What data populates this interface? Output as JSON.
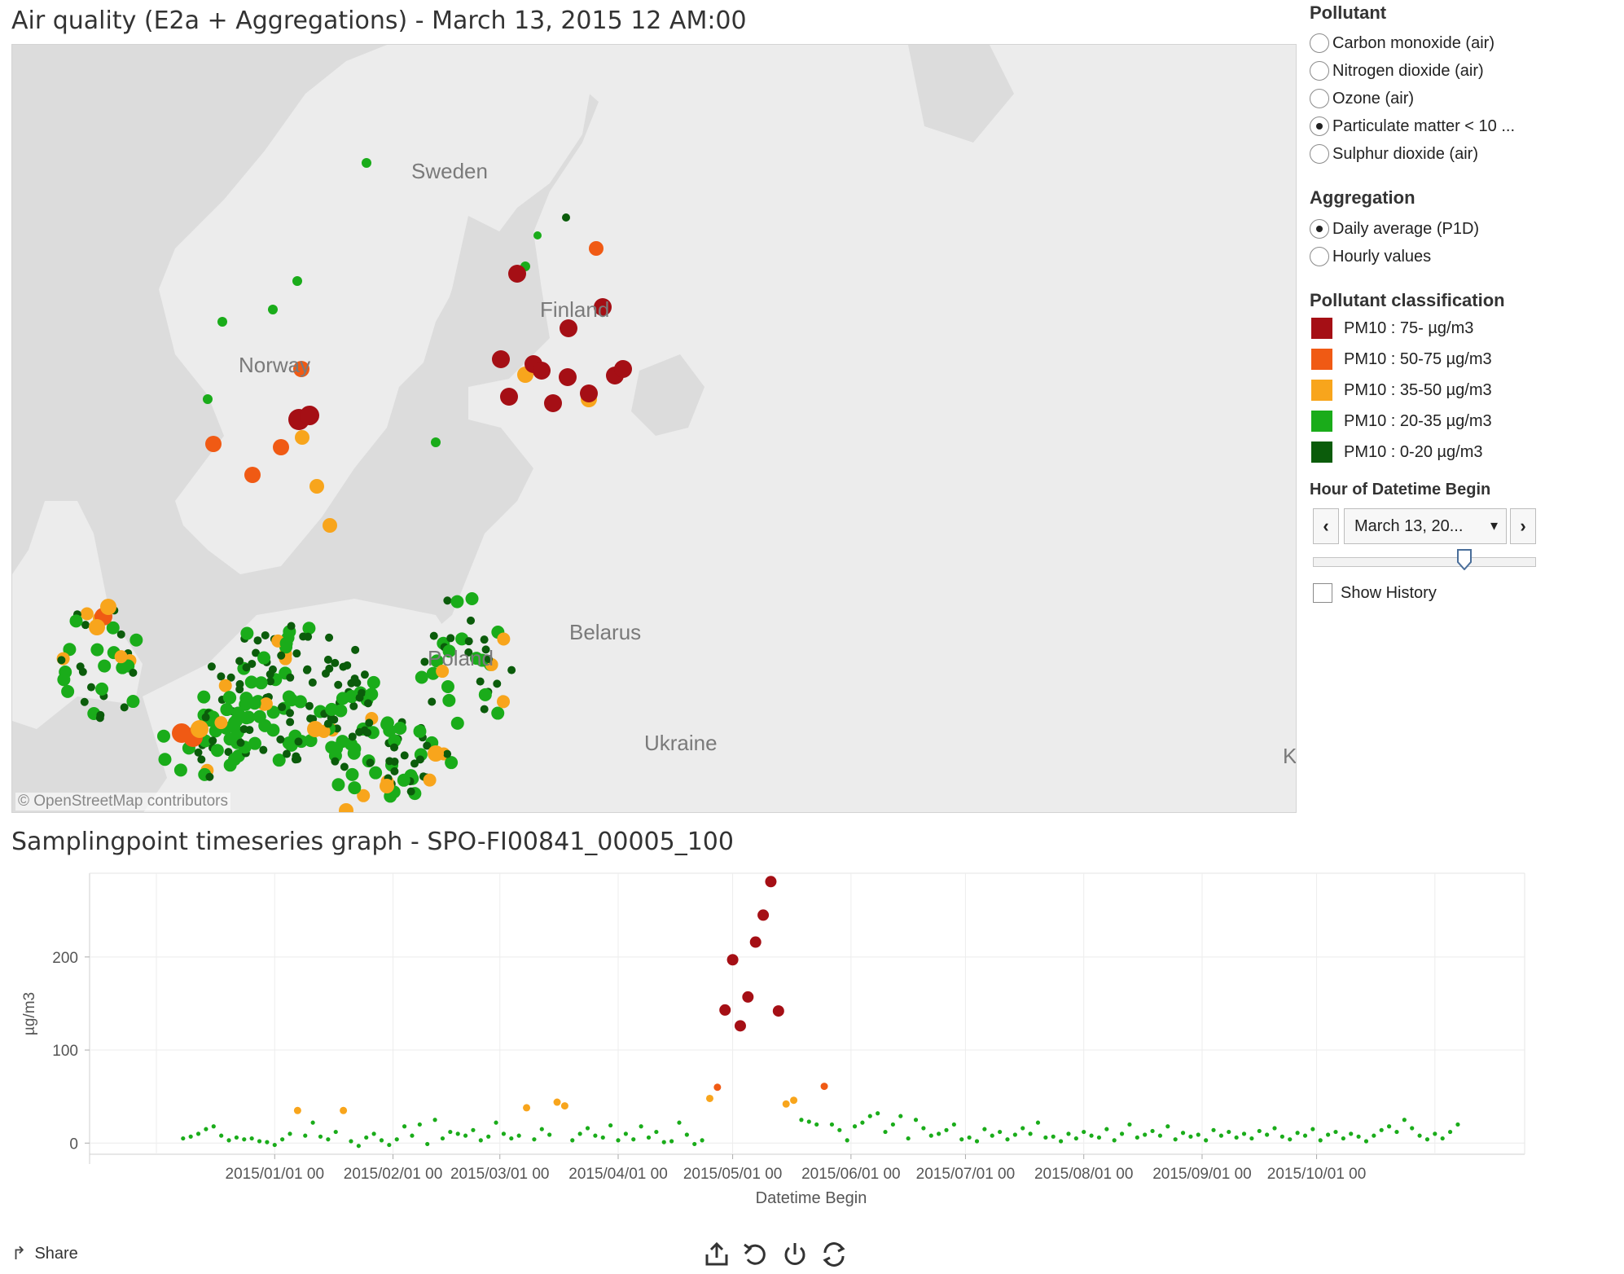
{
  "map": {
    "title": "Air quality (E2a + Aggregations) - March 13, 2015 12 AM:00",
    "labels": {
      "sweden": "Sweden",
      "finland": "Finland",
      "norway": "Norway",
      "belarus": "Belarus",
      "poland": "Poland",
      "ukraine": "Ukraine",
      "edge": "K"
    },
    "attribution": "© OpenStreetMap contributors",
    "colors": {
      "land": "#ececec",
      "water": "#dcdcdc"
    }
  },
  "filters": {
    "pollutant": {
      "title": "Pollutant",
      "options": [
        {
          "label": "Carbon monoxide (air)",
          "selected": false
        },
        {
          "label": "Nitrogen dioxide (air)",
          "selected": false
        },
        {
          "label": "Ozone (air)",
          "selected": false
        },
        {
          "label": "Particulate matter < 10 ...",
          "selected": true
        },
        {
          "label": "Sulphur dioxide (air)",
          "selected": false
        }
      ]
    },
    "aggregation": {
      "title": "Aggregation",
      "options": [
        {
          "label": "Daily average (P1D)",
          "selected": true
        },
        {
          "label": "Hourly values",
          "selected": false
        }
      ]
    },
    "classification": {
      "title": "Pollutant classification",
      "items": [
        {
          "label": "PM10 : 75- µg/m3",
          "color": "#a50f15"
        },
        {
          "label": "PM10 : 50-75 µg/m3",
          "color": "#f05a14"
        },
        {
          "label": "PM10 : 35-50 µg/m3",
          "color": "#f8a51c"
        },
        {
          "label": "PM10 : 20-35 µg/m3",
          "color": "#1aac1a"
        },
        {
          "label": "PM10 : 0-20 µg/m3",
          "color": "#0b5c0b"
        }
      ]
    },
    "hour": {
      "title": "Hour of Datetime Begin",
      "value": "March 13, 20...",
      "prev_icon": "chevron-left-icon",
      "next_icon": "chevron-right-icon",
      "slider_position": 0.68
    },
    "show_history": {
      "label": "Show History",
      "checked": false
    }
  },
  "graph": {
    "title": "Samplingpoint timeseries graph - SPO-FI00841_00005_100"
  },
  "chart_data": {
    "type": "scatter",
    "xlabel": "Datetime Begin",
    "ylabel": "µg/m3",
    "xlim": [
      "2014-12-01",
      "2015-11-10"
    ],
    "ylim": [
      -12,
      290
    ],
    "yticks": [
      0,
      100,
      200
    ],
    "xticks": [
      "2015/01/01 00",
      "2015/02/01 00",
      "2015/03/01 00",
      "2015/04/01 00",
      "2015/05/01 00",
      "2015/06/01 00",
      "2015/07/01 00",
      "2015/08/01 00",
      "2015/09/01 00",
      "2015/10/01 00"
    ],
    "grid": true,
    "color_scale": [
      {
        "min": 75,
        "color": "#a50f15"
      },
      {
        "min": 50,
        "color": "#f05a14"
      },
      {
        "min": 35,
        "color": "#f8a51c"
      },
      {
        "min": 20,
        "color": "#1aac1a"
      },
      {
        "min": 0,
        "color": "#1aac1a"
      }
    ],
    "points": [
      [
        "2014-12-08",
        5
      ],
      [
        "2014-12-10",
        7
      ],
      [
        "2014-12-12",
        10
      ],
      [
        "2014-12-14",
        15
      ],
      [
        "2014-12-16",
        18
      ],
      [
        "2014-12-18",
        8
      ],
      [
        "2014-12-20",
        3
      ],
      [
        "2014-12-22",
        6
      ],
      [
        "2014-12-24",
        4
      ],
      [
        "2014-12-26",
        5
      ],
      [
        "2014-12-28",
        2
      ],
      [
        "2014-12-30",
        1
      ],
      [
        "2015-01-01",
        -2
      ],
      [
        "2015-01-03",
        4
      ],
      [
        "2015-01-05",
        10
      ],
      [
        "2015-01-07",
        35
      ],
      [
        "2015-01-09",
        8
      ],
      [
        "2015-01-11",
        22
      ],
      [
        "2015-01-13",
        7
      ],
      [
        "2015-01-15",
        4
      ],
      [
        "2015-01-17",
        12
      ],
      [
        "2015-01-19",
        35
      ],
      [
        "2015-01-21",
        2
      ],
      [
        "2015-01-23",
        -3
      ],
      [
        "2015-01-25",
        6
      ],
      [
        "2015-01-27",
        10
      ],
      [
        "2015-01-29",
        3
      ],
      [
        "2015-01-31",
        -2
      ],
      [
        "2015-02-02",
        4
      ],
      [
        "2015-02-04",
        18
      ],
      [
        "2015-02-06",
        8
      ],
      [
        "2015-02-08",
        20
      ],
      [
        "2015-02-10",
        -1
      ],
      [
        "2015-02-12",
        25
      ],
      [
        "2015-02-14",
        5
      ],
      [
        "2015-02-16",
        12
      ],
      [
        "2015-02-18",
        10
      ],
      [
        "2015-02-20",
        8
      ],
      [
        "2015-02-22",
        14
      ],
      [
        "2015-02-24",
        3
      ],
      [
        "2015-02-26",
        7
      ],
      [
        "2015-02-28",
        22
      ],
      [
        "2015-03-02",
        10
      ],
      [
        "2015-03-04",
        5
      ],
      [
        "2015-03-06",
        8
      ],
      [
        "2015-03-08",
        38
      ],
      [
        "2015-03-10",
        4
      ],
      [
        "2015-03-12",
        15
      ],
      [
        "2015-03-14",
        9
      ],
      [
        "2015-03-16",
        44
      ],
      [
        "2015-03-18",
        40
      ],
      [
        "2015-03-20",
        3
      ],
      [
        "2015-03-22",
        10
      ],
      [
        "2015-03-24",
        16
      ],
      [
        "2015-03-26",
        8
      ],
      [
        "2015-03-28",
        6
      ],
      [
        "2015-03-30",
        19
      ],
      [
        "2015-04-01",
        3
      ],
      [
        "2015-04-03",
        10
      ],
      [
        "2015-04-05",
        4
      ],
      [
        "2015-04-07",
        18
      ],
      [
        "2015-04-09",
        6
      ],
      [
        "2015-04-11",
        12
      ],
      [
        "2015-04-13",
        1
      ],
      [
        "2015-04-15",
        2
      ],
      [
        "2015-04-17",
        22
      ],
      [
        "2015-04-19",
        9
      ],
      [
        "2015-04-21",
        -1
      ],
      [
        "2015-04-23",
        3
      ],
      [
        "2015-04-25",
        48
      ],
      [
        "2015-04-27",
        60
      ],
      [
        "2015-04-29",
        143
      ],
      [
        "2015-05-01",
        197
      ],
      [
        "2015-05-03",
        126
      ],
      [
        "2015-05-05",
        157
      ],
      [
        "2015-05-07",
        216
      ],
      [
        "2015-05-09",
        245
      ],
      [
        "2015-05-11",
        281
      ],
      [
        "2015-05-13",
        142
      ],
      [
        "2015-05-15",
        42
      ],
      [
        "2015-05-17",
        46
      ],
      [
        "2015-05-19",
        25
      ],
      [
        "2015-05-21",
        23
      ],
      [
        "2015-05-23",
        20
      ],
      [
        "2015-05-25",
        61
      ],
      [
        "2015-05-27",
        20
      ],
      [
        "2015-05-29",
        14
      ],
      [
        "2015-05-31",
        3
      ],
      [
        "2015-06-02",
        18
      ],
      [
        "2015-06-04",
        22
      ],
      [
        "2015-06-06",
        29
      ],
      [
        "2015-06-08",
        32
      ],
      [
        "2015-06-10",
        12
      ],
      [
        "2015-06-12",
        20
      ],
      [
        "2015-06-14",
        29
      ],
      [
        "2015-06-16",
        5
      ],
      [
        "2015-06-18",
        25
      ],
      [
        "2015-06-20",
        16
      ],
      [
        "2015-06-22",
        8
      ],
      [
        "2015-06-24",
        10
      ],
      [
        "2015-06-26",
        14
      ],
      [
        "2015-06-28",
        20
      ],
      [
        "2015-06-30",
        4
      ],
      [
        "2015-07-02",
        6
      ],
      [
        "2015-07-04",
        2
      ],
      [
        "2015-07-06",
        15
      ],
      [
        "2015-07-08",
        8
      ],
      [
        "2015-07-10",
        12
      ],
      [
        "2015-07-12",
        4
      ],
      [
        "2015-07-14",
        9
      ],
      [
        "2015-07-16",
        16
      ],
      [
        "2015-07-18",
        10
      ],
      [
        "2015-07-20",
        22
      ],
      [
        "2015-07-22",
        6
      ],
      [
        "2015-07-24",
        7
      ],
      [
        "2015-07-26",
        2
      ],
      [
        "2015-07-28",
        10
      ],
      [
        "2015-07-30",
        5
      ],
      [
        "2015-08-01",
        12
      ],
      [
        "2015-08-03",
        8
      ],
      [
        "2015-08-05",
        6
      ],
      [
        "2015-08-07",
        15
      ],
      [
        "2015-08-09",
        3
      ],
      [
        "2015-08-11",
        10
      ],
      [
        "2015-08-13",
        20
      ],
      [
        "2015-08-15",
        6
      ],
      [
        "2015-08-17",
        9
      ],
      [
        "2015-08-19",
        13
      ],
      [
        "2015-08-21",
        8
      ],
      [
        "2015-08-23",
        18
      ],
      [
        "2015-08-25",
        4
      ],
      [
        "2015-08-27",
        11
      ],
      [
        "2015-08-29",
        7
      ],
      [
        "2015-08-31",
        9
      ],
      [
        "2015-09-02",
        3
      ],
      [
        "2015-09-04",
        14
      ],
      [
        "2015-09-06",
        8
      ],
      [
        "2015-09-08",
        12
      ],
      [
        "2015-09-10",
        6
      ],
      [
        "2015-09-12",
        10
      ],
      [
        "2015-09-14",
        5
      ],
      [
        "2015-09-16",
        13
      ],
      [
        "2015-09-18",
        9
      ],
      [
        "2015-09-20",
        16
      ],
      [
        "2015-09-22",
        7
      ],
      [
        "2015-09-24",
        4
      ],
      [
        "2015-09-26",
        11
      ],
      [
        "2015-09-28",
        8
      ],
      [
        "2015-09-30",
        15
      ],
      [
        "2015-10-02",
        3
      ],
      [
        "2015-10-04",
        9
      ],
      [
        "2015-10-06",
        12
      ],
      [
        "2015-10-08",
        5
      ],
      [
        "2015-10-10",
        10
      ],
      [
        "2015-10-12",
        7
      ],
      [
        "2015-10-14",
        2
      ],
      [
        "2015-10-16",
        8
      ],
      [
        "2015-10-18",
        14
      ],
      [
        "2015-10-20",
        18
      ],
      [
        "2015-10-22",
        12
      ],
      [
        "2015-10-24",
        25
      ],
      [
        "2015-10-26",
        16
      ],
      [
        "2015-10-28",
        8
      ],
      [
        "2015-10-30",
        4
      ],
      [
        "2015-11-01",
        10
      ],
      [
        "2015-11-03",
        5
      ],
      [
        "2015-11-05",
        12
      ],
      [
        "2015-11-07",
        20
      ]
    ]
  },
  "footer": {
    "share_label": "Share",
    "tools": [
      "share-export-icon",
      "undo-icon",
      "revert-icon",
      "refresh-icon"
    ]
  }
}
